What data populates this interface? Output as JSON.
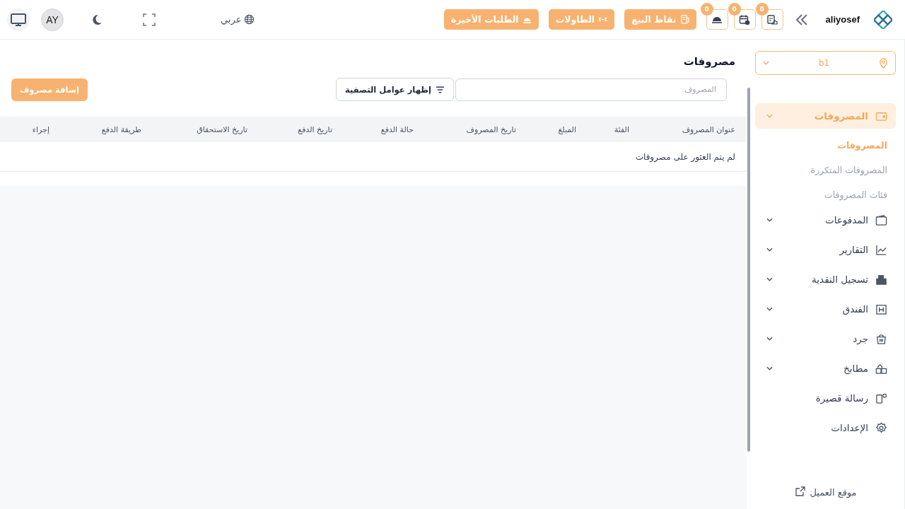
{
  "topbar": {
    "brand": "aliyosef",
    "icon_buttons": [
      {
        "badge": "0"
      },
      {
        "badge": "0"
      },
      {
        "badge": "0"
      }
    ],
    "actions": [
      {
        "label": "نقاط البيع"
      },
      {
        "label": "الطاولات"
      },
      {
        "label": "الطلبات الأخيرة"
      }
    ],
    "language": "عربي",
    "avatar": "AY"
  },
  "sidebar": {
    "branch": "b1",
    "items": [
      {
        "label": "المصروفات",
        "expandable": true,
        "selected": true,
        "children": [
          {
            "label": "المصروفات",
            "selected": true
          },
          {
            "label": "المصروفات المتكررة",
            "selected": false
          },
          {
            "label": "فئات المصروفات",
            "selected": false
          }
        ]
      },
      {
        "label": "المدفوعات",
        "expandable": true,
        "selected": false
      },
      {
        "label": "التقارير",
        "expandable": true,
        "selected": false
      },
      {
        "label": "تسجيل النقدية",
        "expandable": true,
        "selected": false
      },
      {
        "label": "الفندق",
        "expandable": true,
        "selected": false
      },
      {
        "label": "جرد",
        "expandable": true,
        "selected": false
      },
      {
        "label": "مطابخ",
        "expandable": true,
        "selected": false
      },
      {
        "label": "رسالة قصيرة",
        "expandable": false,
        "selected": false
      },
      {
        "label": "الإعدادات",
        "expandable": false,
        "selected": false
      }
    ],
    "footer_link": "موقع العميل"
  },
  "page": {
    "title": "مصروفات",
    "search": {
      "placeholder": "المصروف"
    },
    "filter_button": "إظهار عوامل التصفية",
    "add_button": "إضافة مصروف",
    "table": {
      "columns": [
        "عنوان المصروف",
        "الفئة",
        "المبلغ",
        "تاريخ المصروف",
        "حالة الدفع",
        "تاريخ الدفع",
        "تاريخ الاستحقاق",
        "طريقة الدفع",
        "إجراء"
      ],
      "empty_message": "لم يتم العثور على مصروفات"
    }
  }
}
